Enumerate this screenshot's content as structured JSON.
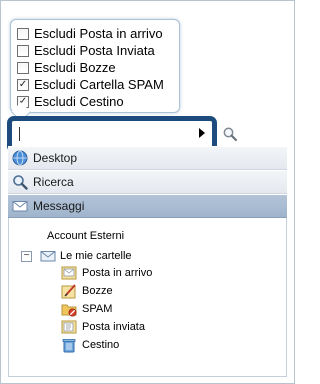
{
  "filters": {
    "options": [
      {
        "label": "Escludi Posta in arrivo",
        "checked": false
      },
      {
        "label": "Escludi Posta Inviata",
        "checked": false
      },
      {
        "label": "Escludi Bozze",
        "checked": false
      },
      {
        "label": "Escludi Cartella SPAM",
        "checked": true
      },
      {
        "label": "Escludi Cestino",
        "checked": true
      }
    ]
  },
  "search": {
    "value": ""
  },
  "nav": {
    "desktop": "Desktop",
    "ricerca": "Ricerca",
    "messaggi": "Messaggi"
  },
  "tree": {
    "account_header": "Account Esterni",
    "root_label": "Le mie cartelle",
    "expander": "−",
    "folders": [
      {
        "label": "Posta in arrivo",
        "icon": "inbox-icon"
      },
      {
        "label": "Bozze",
        "icon": "drafts-icon"
      },
      {
        "label": "SPAM",
        "icon": "spam-icon"
      },
      {
        "label": "Posta inviata",
        "icon": "sent-icon"
      },
      {
        "label": "Cestino",
        "icon": "trash-icon"
      }
    ]
  },
  "colors": {
    "accent": "#1e4b7e",
    "active_nav": "#a9bcd2"
  }
}
